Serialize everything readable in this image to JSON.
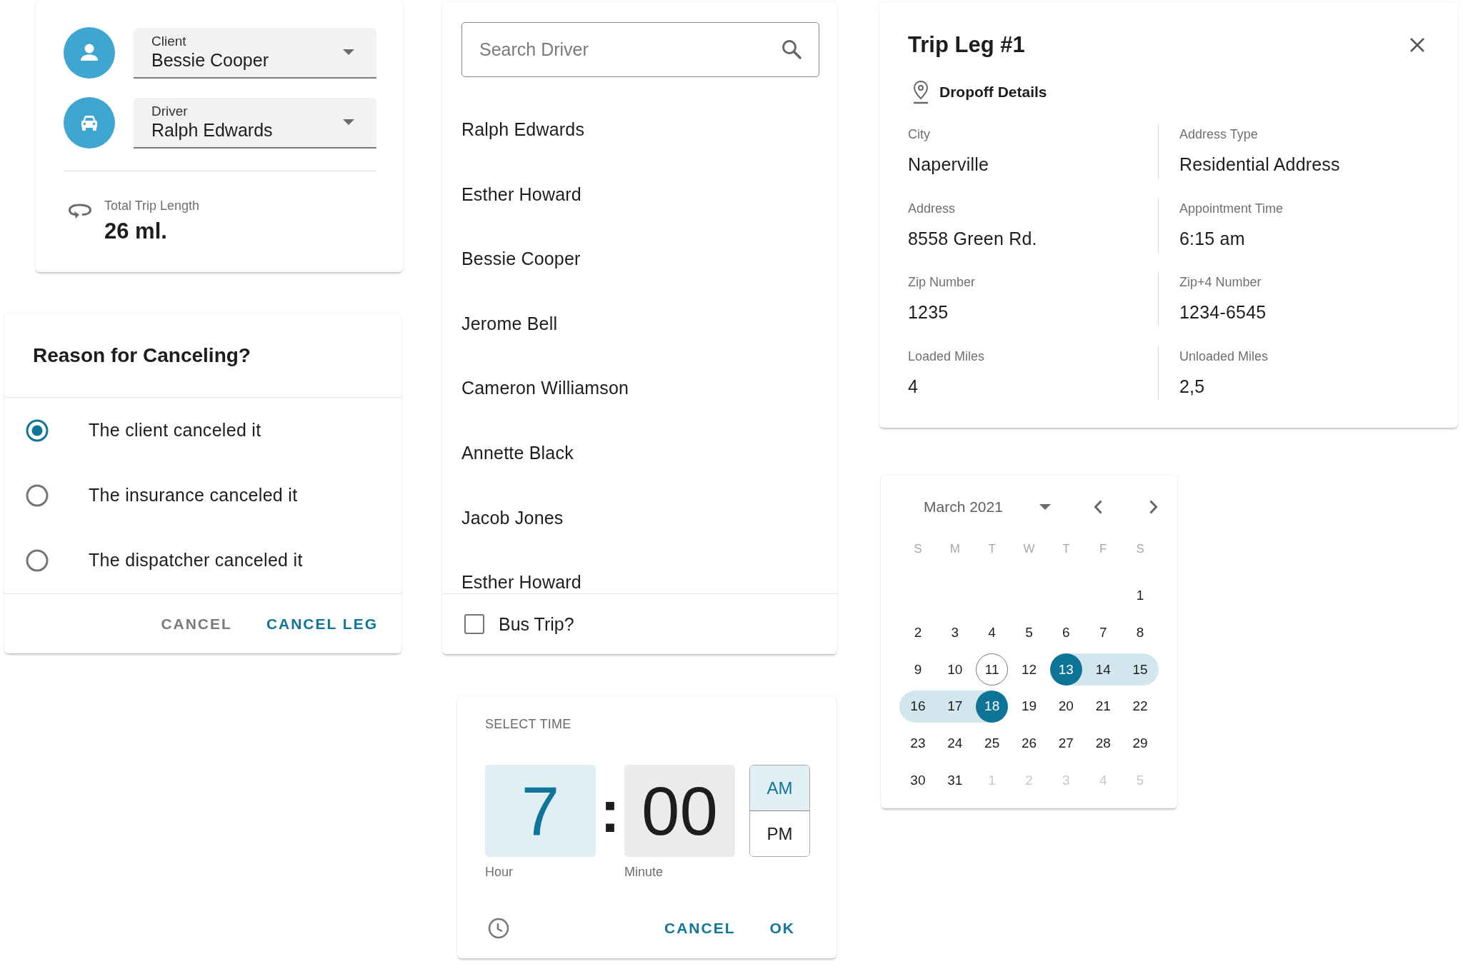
{
  "trip_summary": {
    "selects": [
      {
        "kind": "client",
        "label": "Client",
        "value": "Bessie Cooper"
      },
      {
        "kind": "driver",
        "label": "Driver",
        "value": "Ralph Edwards"
      }
    ],
    "total_trip_length": {
      "label": "Total Trip Length",
      "value": "26 ml."
    }
  },
  "cancel_dialog": {
    "title": "Reason for Canceling?",
    "options": [
      {
        "label": "The client canceled it",
        "selected": true
      },
      {
        "label": "The insurance canceled it",
        "selected": false
      },
      {
        "label": "The dispatcher canceled it",
        "selected": false
      }
    ],
    "buttons": [
      {
        "label": "CANCEL",
        "kind": "secondary"
      },
      {
        "label": "CANCEL LEG",
        "kind": "primary"
      }
    ]
  },
  "driver_picker": {
    "search": {
      "placeholder": "Search Driver"
    },
    "drivers": [
      "Ralph Edwards",
      "Esther Howard",
      "Bessie Cooper",
      "Jerome Bell",
      "Cameron Williamson",
      "Annette Black",
      "Jacob Jones",
      "Esther Howard"
    ],
    "bus_trip": {
      "label": "Bus Trip?",
      "checked": false
    }
  },
  "trip_leg": {
    "title": "Trip Leg #1",
    "section": "Dropoff Details",
    "fields": [
      {
        "label": "City",
        "value": "Naperville"
      },
      {
        "label": "Address Type",
        "value": "Residential Address"
      },
      {
        "label": "Address",
        "value": "8558 Green Rd."
      },
      {
        "label": "Appointment Time",
        "value": "6:15 am"
      },
      {
        "label": "Zip Number",
        "value": "1235"
      },
      {
        "label": "Zip+4 Number",
        "value": "1234-6545"
      },
      {
        "label": "Loaded Miles",
        "value": "4"
      },
      {
        "label": "Unloaded Miles",
        "value": "2,5"
      }
    ]
  },
  "calendar": {
    "month": "March 2021",
    "weekdays": [
      "S",
      "M",
      "T",
      "W",
      "T",
      "F",
      "S"
    ],
    "weeks": [
      [
        {
          "day": "1",
          "selected": false,
          "in_range": false,
          "today": false,
          "outside": false
        }
      ],
      [
        {
          "day": "2",
          "selected": false,
          "in_range": false,
          "today": false,
          "outside": false
        },
        {
          "day": "3",
          "selected": false,
          "in_range": false,
          "today": false,
          "outside": false
        },
        {
          "day": "4",
          "selected": false,
          "in_range": false,
          "today": false,
          "outside": false
        },
        {
          "day": "5",
          "selected": false,
          "in_range": false,
          "today": false,
          "outside": false
        },
        {
          "day": "6",
          "selected": false,
          "in_range": false,
          "today": false,
          "outside": false
        },
        {
          "day": "7",
          "selected": false,
          "in_range": false,
          "today": false,
          "outside": false
        },
        {
          "day": "8",
          "selected": false,
          "in_range": false,
          "today": false,
          "outside": false
        }
      ],
      [
        {
          "day": "9",
          "selected": false,
          "in_range": false,
          "today": false,
          "outside": false
        },
        {
          "day": "10",
          "selected": false,
          "in_range": false,
          "today": false,
          "outside": false
        },
        {
          "day": "11",
          "selected": false,
          "in_range": false,
          "today": true,
          "outside": false
        },
        {
          "day": "12",
          "selected": false,
          "in_range": false,
          "today": false,
          "outside": false
        },
        {
          "day": "13",
          "selected": true,
          "in_range": false,
          "today": false,
          "outside": false
        },
        {
          "day": "14",
          "selected": false,
          "in_range": true,
          "today": false,
          "outside": false
        },
        {
          "day": "15",
          "selected": false,
          "in_range": true,
          "today": false,
          "outside": false
        }
      ],
      [
        {
          "day": "16",
          "selected": false,
          "in_range": true,
          "today": false,
          "outside": false
        },
        {
          "day": "17",
          "selected": false,
          "in_range": true,
          "today": false,
          "outside": false
        },
        {
          "day": "18",
          "selected": true,
          "in_range": false,
          "today": false,
          "outside": false
        },
        {
          "day": "19",
          "selected": false,
          "in_range": false,
          "today": false,
          "outside": false
        },
        {
          "day": "20",
          "selected": false,
          "in_range": false,
          "today": false,
          "outside": false
        },
        {
          "day": "21",
          "selected": false,
          "in_range": false,
          "today": false,
          "outside": false
        },
        {
          "day": "22",
          "selected": false,
          "in_range": false,
          "today": false,
          "outside": false
        }
      ],
      [
        {
          "day": "23",
          "selected": false,
          "in_range": false,
          "today": false,
          "outside": false
        },
        {
          "day": "24",
          "selected": false,
          "in_range": false,
          "today": false,
          "outside": false
        },
        {
          "day": "25",
          "selected": false,
          "in_range": false,
          "today": false,
          "outside": false
        },
        {
          "day": "26",
          "selected": false,
          "in_range": false,
          "today": false,
          "outside": false
        },
        {
          "day": "27",
          "selected": false,
          "in_range": false,
          "today": false,
          "outside": false
        },
        {
          "day": "28",
          "selected": false,
          "in_range": false,
          "today": false,
          "outside": false
        },
        {
          "day": "29",
          "selected": false,
          "in_range": false,
          "today": false,
          "outside": false
        }
      ],
      [
        {
          "day": "30",
          "selected": false,
          "in_range": false,
          "today": false,
          "outside": false
        },
        {
          "day": "31",
          "selected": false,
          "in_range": false,
          "today": false,
          "outside": false
        },
        {
          "day": "1",
          "selected": false,
          "in_range": false,
          "today": false,
          "outside": true
        },
        {
          "day": "2",
          "selected": false,
          "in_range": false,
          "today": false,
          "outside": true
        },
        {
          "day": "3",
          "selected": false,
          "in_range": false,
          "today": false,
          "outside": true
        },
        {
          "day": "4",
          "selected": false,
          "in_range": false,
          "today": false,
          "outside": true
        },
        {
          "day": "5",
          "selected": false,
          "in_range": false,
          "today": false,
          "outside": true
        }
      ]
    ]
  },
  "time_picker": {
    "title": "SELECT TIME",
    "hour": {
      "value": "7",
      "label": "Hour",
      "selected": true
    },
    "separator": ":",
    "minute": {
      "value": "00",
      "label": "Minute",
      "selected": false
    },
    "periods": [
      {
        "label": "AM",
        "selected": true
      },
      {
        "label": "PM",
        "selected": false
      }
    ],
    "buttons": [
      {
        "label": "CANCEL",
        "kind": "primary"
      },
      {
        "label": "OK",
        "kind": "primary"
      }
    ]
  }
}
